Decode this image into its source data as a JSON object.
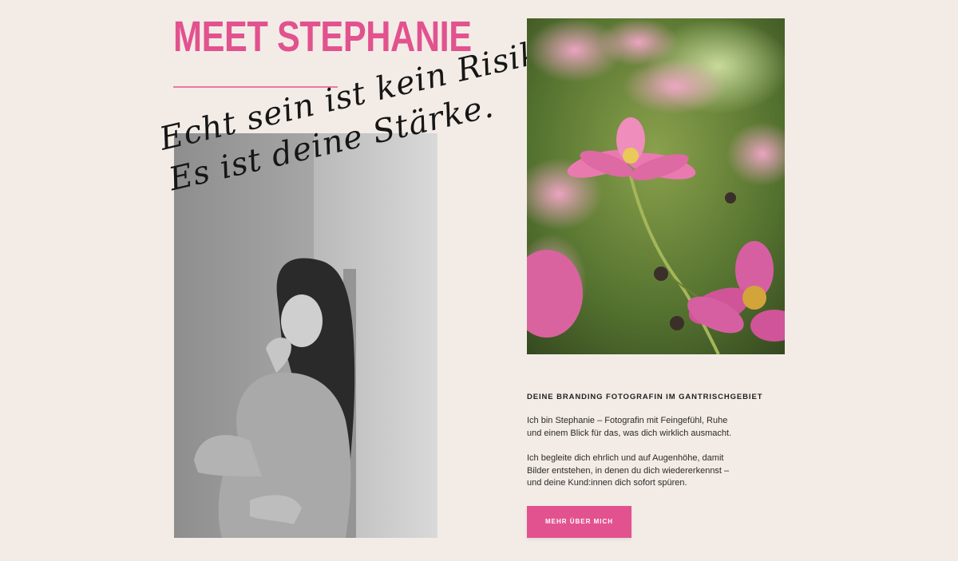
{
  "about": {
    "heading": "MEET STEPHANIE",
    "script_line_1": "Echt sein ist kein Risiko.",
    "script_line_2": "Es ist deine Stärke.",
    "subheading": "DEINE BRANDING FOTOGRAFIN IM GANTRISCHGEBIET",
    "paragraph_1": "Ich bin Stephanie – Fotografin mit Feingefühl, Ruhe und einem Blick für das, was dich wirklich ausmacht.",
    "paragraph_2": "Ich begleite dich ehrlich und auf Augenhöhe, damit Bilder entstehen, in denen du dich wiedererkennst – und deine Kund:innen dich sofort spüren.",
    "cta_label": "MEHR ÜBER MICH"
  },
  "colors": {
    "background": "#f3ece6",
    "accent": "#e2528f",
    "text": "#1f1f1f"
  },
  "images": {
    "portrait": "black-and-white portrait photo",
    "flower": "pink cosmos flower photo"
  }
}
